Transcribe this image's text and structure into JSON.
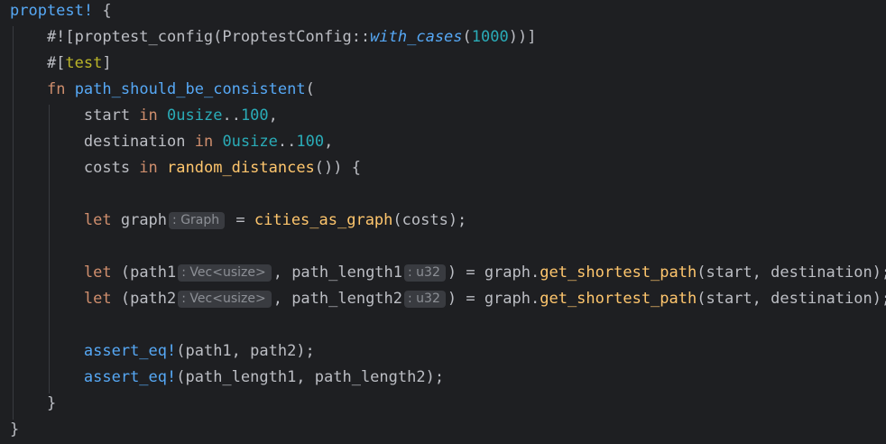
{
  "editor": {
    "lines": [
      [
        {
          "t": "proptest!",
          "c": "macro"
        },
        {
          "t": " {",
          "c": "plain"
        }
      ],
      [
        {
          "t": "    #![proptest_config(ProptestConfig::",
          "c": "plain"
        },
        {
          "t": "with_cases",
          "c": "italic"
        },
        {
          "t": "(",
          "c": "plain"
        },
        {
          "t": "1000",
          "c": "num"
        },
        {
          "t": "))]",
          "c": "plain"
        }
      ],
      [
        {
          "t": "    #[",
          "c": "plain"
        },
        {
          "t": "test",
          "c": "attr"
        },
        {
          "t": "]",
          "c": "plain"
        }
      ],
      [
        {
          "t": "    ",
          "c": "plain"
        },
        {
          "t": "fn",
          "c": "kw"
        },
        {
          "t": " ",
          "c": "plain"
        },
        {
          "t": "path_should_be_consistent",
          "c": "fn-def"
        },
        {
          "t": "(",
          "c": "plain"
        }
      ],
      [
        {
          "t": "        start ",
          "c": "plain"
        },
        {
          "t": "in",
          "c": "kw"
        },
        {
          "t": " ",
          "c": "plain"
        },
        {
          "t": "0usize",
          "c": "num"
        },
        {
          "t": "..",
          "c": "plain"
        },
        {
          "t": "100",
          "c": "num"
        },
        {
          "t": ",",
          "c": "plain"
        }
      ],
      [
        {
          "t": "        destination ",
          "c": "plain"
        },
        {
          "t": "in",
          "c": "kw"
        },
        {
          "t": " ",
          "c": "plain"
        },
        {
          "t": "0usize",
          "c": "num"
        },
        {
          "t": "..",
          "c": "plain"
        },
        {
          "t": "100",
          "c": "num"
        },
        {
          "t": ",",
          "c": "plain"
        }
      ],
      [
        {
          "t": "        costs ",
          "c": "plain"
        },
        {
          "t": "in",
          "c": "kw"
        },
        {
          "t": " ",
          "c": "plain"
        },
        {
          "t": "random_distances",
          "c": "fn-call"
        },
        {
          "t": "()) {",
          "c": "plain"
        }
      ],
      [],
      [
        {
          "t": "        ",
          "c": "plain"
        },
        {
          "t": "let",
          "c": "kw"
        },
        {
          "t": " graph",
          "c": "plain"
        },
        {
          "t": ": Graph",
          "c": "hint"
        },
        {
          "t": " = ",
          "c": "plain"
        },
        {
          "t": "cities_as_graph",
          "c": "fn-call"
        },
        {
          "t": "(costs);",
          "c": "plain"
        }
      ],
      [],
      [
        {
          "t": "        ",
          "c": "plain"
        },
        {
          "t": "let",
          "c": "kw"
        },
        {
          "t": " (path1",
          "c": "plain"
        },
        {
          "t": ": Vec<usize>",
          "c": "hint"
        },
        {
          "t": ", path_length1",
          "c": "plain"
        },
        {
          "t": ": u32",
          "c": "hint"
        },
        {
          "t": ") = graph.",
          "c": "plain"
        },
        {
          "t": "get_shortest_path",
          "c": "fn-call"
        },
        {
          "t": "(start, destination);",
          "c": "plain"
        }
      ],
      [
        {
          "t": "        ",
          "c": "plain"
        },
        {
          "t": "let",
          "c": "kw"
        },
        {
          "t": " (path2",
          "c": "plain"
        },
        {
          "t": ": Vec<usize>",
          "c": "hint"
        },
        {
          "t": ", path_length2",
          "c": "plain"
        },
        {
          "t": ": u32",
          "c": "hint"
        },
        {
          "t": ") = graph.",
          "c": "plain"
        },
        {
          "t": "get_shortest_path",
          "c": "fn-call"
        },
        {
          "t": "(start, destination);",
          "c": "plain"
        }
      ],
      [],
      [
        {
          "t": "        ",
          "c": "plain"
        },
        {
          "t": "assert_eq!",
          "c": "macro"
        },
        {
          "t": "(path1, path2);",
          "c": "plain"
        }
      ],
      [
        {
          "t": "        ",
          "c": "plain"
        },
        {
          "t": "assert_eq!",
          "c": "macro"
        },
        {
          "t": "(path_length1, path_length2);",
          "c": "plain"
        }
      ],
      [
        {
          "t": "    }",
          "c": "plain"
        }
      ],
      [
        {
          "t": "}",
          "c": "plain"
        }
      ]
    ]
  },
  "colors": {
    "background": "#1e1f22",
    "text": "#bcbec4",
    "keyword": "#cf8e6d",
    "number": "#2aacb8",
    "function_decl": "#56a8f5",
    "function_call": "#ffc66d",
    "macro": "#56a8f5",
    "attribute": "#bbb529",
    "inlay_hint_bg": "#393b40",
    "inlay_hint_text": "#8c8f95"
  }
}
